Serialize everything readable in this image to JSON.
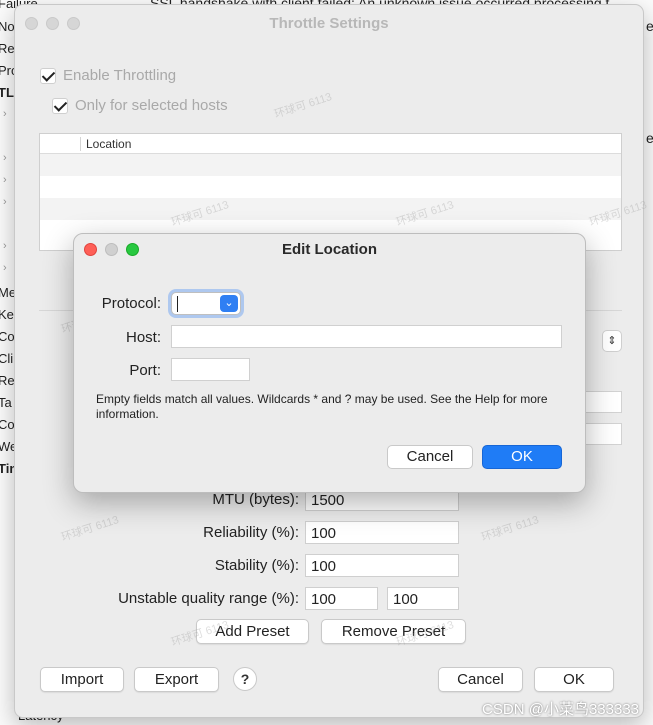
{
  "background": {
    "top_text": "SSL handshake with client failed: An unknown issue occurred processing t",
    "right_fragments": [
      "es",
      "e"
    ],
    "left_items": [
      {
        "label": "Failure",
        "bold": false
      },
      {
        "label": "No",
        "bold": false
      },
      {
        "label": "Re",
        "bold": false
      },
      {
        "label": "Pro",
        "bold": false
      },
      {
        "label": "TL",
        "bold": true
      },
      {
        "label": "Me",
        "bold": false
      },
      {
        "label": "Ke",
        "bold": false
      },
      {
        "label": "Co",
        "bold": false
      },
      {
        "label": "Cli",
        "bold": false
      },
      {
        "label": "Re",
        "bold": false
      },
      {
        "label": "Ta",
        "bold": false
      },
      {
        "label": "Co",
        "bold": false
      },
      {
        "label": "We",
        "bold": false
      },
      {
        "label": "Tin",
        "bold": true
      }
    ],
    "bottom_text": "Latency"
  },
  "throttle_window": {
    "title": "Throttle Settings",
    "enable_throttling": {
      "label": "Enable Throttling",
      "checked": true
    },
    "only_selected_hosts": {
      "label": "Only for selected hosts",
      "checked": true
    },
    "locations_table": {
      "column_header": "Location",
      "rows": []
    },
    "form": {
      "mtu": {
        "label": "MTU (bytes):",
        "value": "1500"
      },
      "reliability": {
        "label": "Reliability (%):",
        "value": "100"
      },
      "stability": {
        "label": "Stability (%):",
        "value": "100"
      },
      "unstable_range": {
        "label": "Unstable quality range (%):",
        "value_min": "100",
        "value_max": "100"
      }
    },
    "add_preset_label": "Add Preset",
    "remove_preset_label": "Remove Preset",
    "import_label": "Import",
    "export_label": "Export",
    "help_label": "?",
    "cancel_label": "Cancel",
    "ok_label": "OK"
  },
  "edit_location": {
    "title": "Edit Location",
    "protocol_label": "Protocol:",
    "protocol_value": "",
    "host_label": "Host:",
    "host_value": "",
    "port_label": "Port:",
    "port_value": "",
    "note": "Empty fields match all values. Wildcards * and ? may be used. See the Help for more information.",
    "cancel_label": "Cancel",
    "ok_label": "OK"
  },
  "watermark_text": "环球可 6113",
  "csdn_watermark": "CSDN @小菜鸟333333",
  "colors": {
    "accent": "#1f7cf6",
    "window_bg": "#ececec",
    "close": "#fe5f57",
    "zoom": "#28c840"
  }
}
